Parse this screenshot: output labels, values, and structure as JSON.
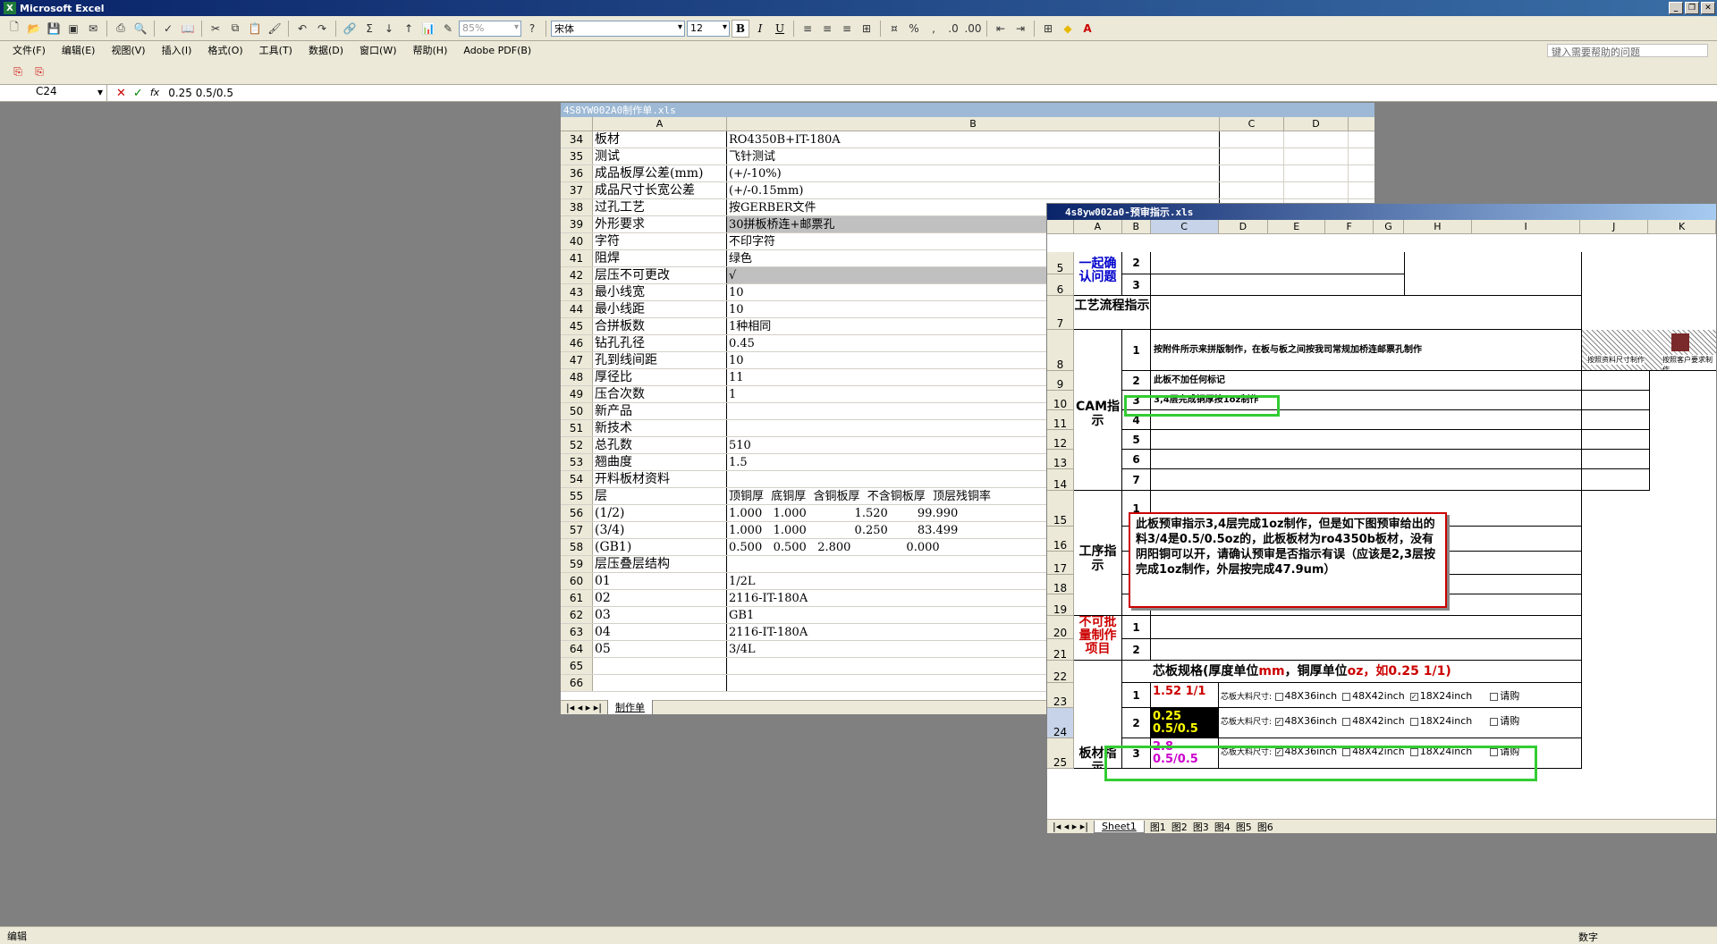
{
  "app": {
    "title": "Microsoft Excel",
    "help_placeholder": "键入需要帮助的问题"
  },
  "toolbar": {
    "zoom": "85%",
    "font": "宋体",
    "size": "12",
    "bold": "B",
    "italic": "I",
    "underline": "U"
  },
  "menu": [
    "文件(F)",
    "编辑(E)",
    "视图(V)",
    "插入(I)",
    "格式(O)",
    "工具(T)",
    "数据(D)",
    "窗口(W)",
    "帮助(H)",
    "Adobe PDF(B)"
  ],
  "formula": {
    "cell": "C24",
    "value": "0.25 0.5/0.5"
  },
  "w1": {
    "title": "4S8YW002A0制作单.xls",
    "cols": [
      "A",
      "B",
      "C",
      "D"
    ],
    "rows": [
      {
        "n": "34",
        "a": "板材",
        "b": "RO4350B+IT-180A"
      },
      {
        "n": "35",
        "a": "测试",
        "b": "飞针测试"
      },
      {
        "n": "36",
        "a": "成品板厚公差(mm)",
        "b": "(+/-10%)"
      },
      {
        "n": "37",
        "a": "成品尺寸长宽公差",
        "b": "(+/-0.15mm)"
      },
      {
        "n": "38",
        "a": "过孔工艺",
        "b": "按GERBER文件"
      },
      {
        "n": "39",
        "a": "外形要求",
        "b": "30拼板桥连+邮票孔",
        "gray": true
      },
      {
        "n": "40",
        "a": "字符",
        "b": "不印字符"
      },
      {
        "n": "41",
        "a": "阻焊",
        "b": "绿色"
      },
      {
        "n": "42",
        "a": "层压不可更改",
        "b": "√",
        "gray": true
      },
      {
        "n": "43",
        "a": "最小线宽",
        "b": "10"
      },
      {
        "n": "44",
        "a": "最小线距",
        "b": "10"
      },
      {
        "n": "45",
        "a": "合拼板数",
        "b": "1种相同"
      },
      {
        "n": "46",
        "a": "钻孔孔径",
        "b": "0.45"
      },
      {
        "n": "47",
        "a": "孔到线间距",
        "b": "10"
      },
      {
        "n": "48",
        "a": "厚径比",
        "b": "11"
      },
      {
        "n": "49",
        "a": "压合次数",
        "b": "1"
      },
      {
        "n": "50",
        "a": "新产品",
        "b": ""
      },
      {
        "n": "51",
        "a": "新技术",
        "b": ""
      },
      {
        "n": "52",
        "a": "总孔数",
        "b": "510"
      },
      {
        "n": "53",
        "a": "翘曲度",
        "b": "1.5"
      },
      {
        "n": "54",
        "a": "开料板材资料",
        "b": ""
      },
      {
        "n": "55",
        "a": "层",
        "b": "顶铜厚  底铜厚  含铜板厚  不含铜板厚  顶层残铜率"
      },
      {
        "n": "56",
        "a": "(1/2)",
        "b": "1.000   1.000             1.520        99.990"
      },
      {
        "n": "57",
        "a": "(3/4)",
        "b": "1.000   1.000             0.250        83.499"
      },
      {
        "n": "58",
        "a": "(GB1)",
        "b": "0.500   0.500   2.800               0.000"
      },
      {
        "n": "59",
        "a": "层压叠层结构",
        "b": ""
      },
      {
        "n": "60",
        "a": "01",
        "b": "1/2L"
      },
      {
        "n": "61",
        "a": "02",
        "b": "2116-IT-180A"
      },
      {
        "n": "62",
        "a": "03",
        "b": "GB1"
      },
      {
        "n": "63",
        "a": "04",
        "b": "2116-IT-180A"
      },
      {
        "n": "64",
        "a": "05",
        "b": "3/4L"
      },
      {
        "n": "65",
        "a": "",
        "b": ""
      },
      {
        "n": "66",
        "a": "",
        "b": ""
      }
    ],
    "sheet": "制作单"
  },
  "w2": {
    "title": "4s8yw002a0-预审指示.xls",
    "cols": [
      "A",
      "B",
      "C",
      "D",
      "E",
      "F",
      "G",
      "H",
      "I",
      "J",
      "K"
    ],
    "confirm_label": "一起确认问题",
    "flow_label": "工艺流程指示",
    "cam_label": "CAM指示",
    "proc_label": "工序指示",
    "batch_label": "不可批量制作项目",
    "board_label": "板材指示",
    "cam_items": [
      "按附件所示来拼版制作，在板与板之间按我司常规加桥连邮票孔制作",
      "此板不加任何标记",
      "3,4层完成铜厚按1oz制作"
    ],
    "hatch_text_1": "按照资料尺寸制作",
    "hatch_text_2": "按照客户要求制作",
    "callout": "此板预审指示3,4层完成1oz制作，但是如下图预审给出的料3/4是0.5/0.5oz的，此板板材为ro4350b板材，没有阴阳铜可以开，请确认预审是否指示有误（应该是2,3层按完成1oz制作，外层按完成47.9um）",
    "core_head_a": "芯板规格(厚度单位",
    "core_head_mm": "mm",
    "core_head_b": "，铜厚单位",
    "core_head_oz": "oz",
    "core_head_c": "，如0.25 1/1)",
    "cores": [
      {
        "n": "1",
        "spec": "1.52 1/1",
        "color": "#cc0000"
      },
      {
        "n": "2",
        "spec": "0.25 0.5/0.5",
        "color": "#ffff00"
      },
      {
        "n": "3",
        "spec": "2.8 0.5/0.5",
        "color": "#cc00cc"
      }
    ],
    "size_label": "芯板大料尺寸:",
    "sizes": [
      "48X36inch",
      "48X42inch",
      "18X24inch",
      "请购"
    ],
    "sheets": [
      "Sheet1",
      "图1",
      "图2",
      "图3",
      "图4",
      "图5",
      "图6"
    ]
  },
  "status": {
    "left": "编辑",
    "right": "数字"
  }
}
